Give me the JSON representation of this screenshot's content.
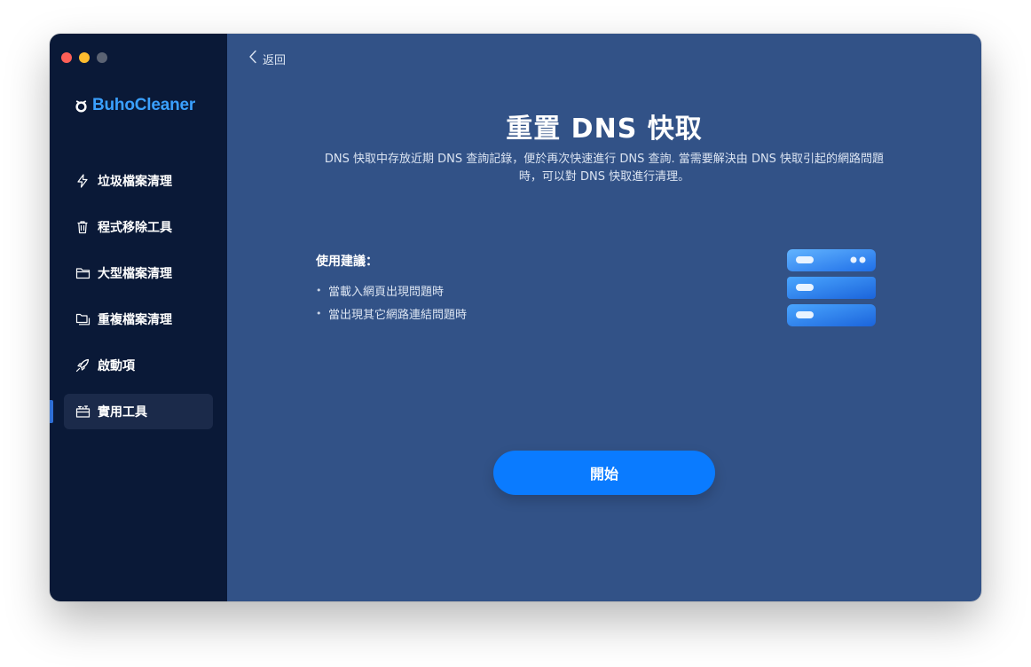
{
  "app": {
    "name": "BuhoCleaner",
    "logo_icon": "buho-logo-icon",
    "accent": "#3aa0ff"
  },
  "window_controls": {
    "close_color": "#fe5f57",
    "minimize_color": "#febc2e",
    "zoom_color": "#5b6373"
  },
  "sidebar": {
    "items": [
      {
        "label": "垃圾檔案清理",
        "icon": "bolt-icon"
      },
      {
        "label": "程式移除工具",
        "icon": "trash-icon"
      },
      {
        "label": "大型檔案清理",
        "icon": "folder-icon"
      },
      {
        "label": "重複檔案清理",
        "icon": "duplicate-folder-icon"
      },
      {
        "label": "啟動項",
        "icon": "rocket-icon"
      },
      {
        "label": "實用工具",
        "icon": "toolbox-icon",
        "active": true
      }
    ]
  },
  "header": {
    "back_label": "返回"
  },
  "main": {
    "title": "重置 DNS 快取",
    "description": "DNS 快取中存放近期 DNS 查詢記錄，便於再次快速進行 DNS 查詢. 當需要解決由 DNS 快取引起的網路問題時，可以對 DNS 快取進行清理。",
    "tips_title": "使用建議：",
    "tips": [
      "當載入網頁出現問題時",
      "當出現其它網路連結問題時"
    ],
    "illustration": "dns-server-icon",
    "start_label": "開始",
    "button_color": "#0a7bff",
    "background_color": "#325287"
  }
}
